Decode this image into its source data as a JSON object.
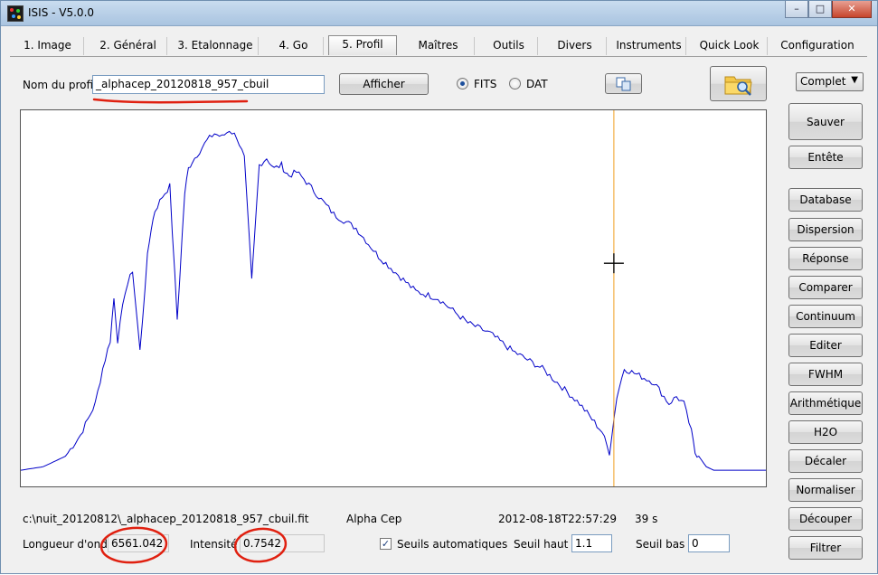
{
  "window": {
    "title": "ISIS - V5.0.0",
    "controls": {
      "minimize": "–",
      "maximize": "□",
      "close": "✕"
    }
  },
  "tabs": [
    {
      "label": "1. Image"
    },
    {
      "label": "2. Général"
    },
    {
      "label": "3. Etalonnage"
    },
    {
      "label": "4. Go"
    },
    {
      "label": "5. Profil",
      "active": true
    },
    {
      "label": "Maîtres"
    },
    {
      "label": "Outils"
    },
    {
      "label": "Divers"
    },
    {
      "label": "Instruments"
    },
    {
      "label": "Quick Look"
    },
    {
      "label": "Configuration"
    }
  ],
  "profile": {
    "name_label": "Nom du profil :",
    "name_value": "_alphacep_20120818_957_cbuil",
    "show_button": "Afficher",
    "fits_label": "FITS",
    "dat_label": "DAT",
    "format_selected": "FITS"
  },
  "icons": {
    "copy": "copy-icon",
    "open": "folder-search-icon"
  },
  "mode_select": {
    "value": "Complet",
    "arrow": "▼"
  },
  "sidebar_top": [
    {
      "label": "Sauver",
      "name": "save-button"
    },
    {
      "label": "Entête",
      "name": "header-button"
    }
  ],
  "sidebar": [
    {
      "label": "Database",
      "name": "database-button"
    },
    {
      "label": "Dispersion",
      "name": "dispersion-button"
    },
    {
      "label": "Réponse",
      "name": "response-button"
    },
    {
      "label": "Comparer",
      "name": "compare-button"
    },
    {
      "label": "Continuum",
      "name": "continuum-button"
    },
    {
      "label": "Editer",
      "name": "edit-button"
    },
    {
      "label": "FWHM",
      "name": "fwhm-button"
    },
    {
      "label": "Arithmétique",
      "name": "arithmetic-button"
    },
    {
      "label": "H2O",
      "name": "h2o-button"
    },
    {
      "label": "Décaler",
      "name": "shift-button"
    },
    {
      "label": "Normaliser",
      "name": "normalize-button"
    },
    {
      "label": "Découper",
      "name": "crop-button"
    },
    {
      "label": "Filtrer",
      "name": "filter-button"
    }
  ],
  "status": {
    "file_path": "c:\\nuit_20120812\\_alphacep_20120818_957_cbuil.fit",
    "object": "Alpha Cep",
    "datetime": "2012-08-18T22:57:29",
    "exposure": "39 s",
    "wavelength_label": "Longueur d'onde :",
    "wavelength_value": "6561.042",
    "intensity_label": "Intensité :",
    "intensity_value": "0.7542",
    "auto_threshold_label": "Seuils automatiques",
    "auto_threshold_checked": true,
    "high_label": "Seuil haut :",
    "high_value": "1.1",
    "low_label": "Seuil bas :",
    "low_value": "0"
  },
  "colors": {
    "spectrum": "#0000c8",
    "cursor_line": "#f0a020",
    "annotation": "#e02010"
  },
  "chart_data": {
    "type": "line",
    "x": [
      0.0,
      0.03,
      0.06,
      0.08,
      0.1,
      0.11,
      0.12,
      0.125,
      0.13,
      0.14,
      0.15,
      0.16,
      0.17,
      0.175,
      0.18,
      0.19,
      0.2,
      0.21,
      0.22,
      0.225,
      0.23,
      0.24,
      0.25,
      0.26,
      0.27,
      0.28,
      0.29,
      0.3,
      0.31,
      0.32,
      0.33,
      0.34,
      0.35,
      0.355,
      0.36,
      0.37,
      0.38,
      0.4,
      0.42,
      0.45,
      0.48,
      0.5,
      0.53,
      0.56,
      0.6,
      0.63,
      0.66,
      0.7,
      0.72,
      0.75,
      0.78,
      0.79,
      0.8,
      0.81,
      0.82,
      0.85,
      0.87,
      0.88,
      0.89,
      0.9,
      0.905,
      0.91,
      0.92,
      0.93,
      0.95,
      0.97,
      1.0
    ],
    "y": [
      0.01,
      0.02,
      0.05,
      0.11,
      0.2,
      0.3,
      0.38,
      0.5,
      0.38,
      0.52,
      0.58,
      0.35,
      0.62,
      0.7,
      0.75,
      0.79,
      0.82,
      0.44,
      0.8,
      0.87,
      0.89,
      0.92,
      0.95,
      0.97,
      0.96,
      0.98,
      0.96,
      0.9,
      0.55,
      0.88,
      0.9,
      0.87,
      0.88,
      0.86,
      0.85,
      0.86,
      0.84,
      0.79,
      0.74,
      0.7,
      0.62,
      0.58,
      0.52,
      0.5,
      0.43,
      0.4,
      0.35,
      0.3,
      0.26,
      0.2,
      0.12,
      0.06,
      0.22,
      0.3,
      0.29,
      0.26,
      0.2,
      0.22,
      0.2,
      0.12,
      0.06,
      0.05,
      0.02,
      0.01,
      0.01,
      0.01,
      0.01
    ],
    "xlim": [
      0,
      1
    ],
    "ylim": [
      0,
      1
    ],
    "cursor_x": 0.796,
    "cursor_y": 0.6,
    "grid": false
  }
}
